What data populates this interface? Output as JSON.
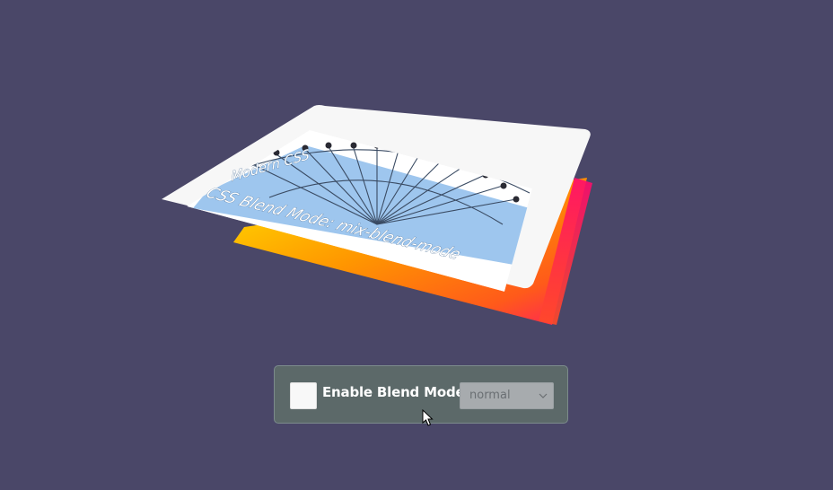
{
  "card": {
    "title_line1": "Modern CSS",
    "title_line2": "CSS Blend Mode: mix-blend-mode"
  },
  "controls": {
    "checkbox_label": "Enable Blend Mode",
    "checkbox_checked": false,
    "select_value": "normal"
  },
  "icons": {
    "select_chevron": "chevron-down-icon",
    "pointer": "mouse-pointer-icon"
  },
  "colors": {
    "background": "#4a4768",
    "panel": "#5c6969",
    "card_white": "#f7f7f7",
    "image_blue": "#9ec6ee",
    "gradient_yellow": "#ffd400",
    "gradient_orange": "#ff7a00",
    "gradient_pink": "#ff0a6e"
  }
}
